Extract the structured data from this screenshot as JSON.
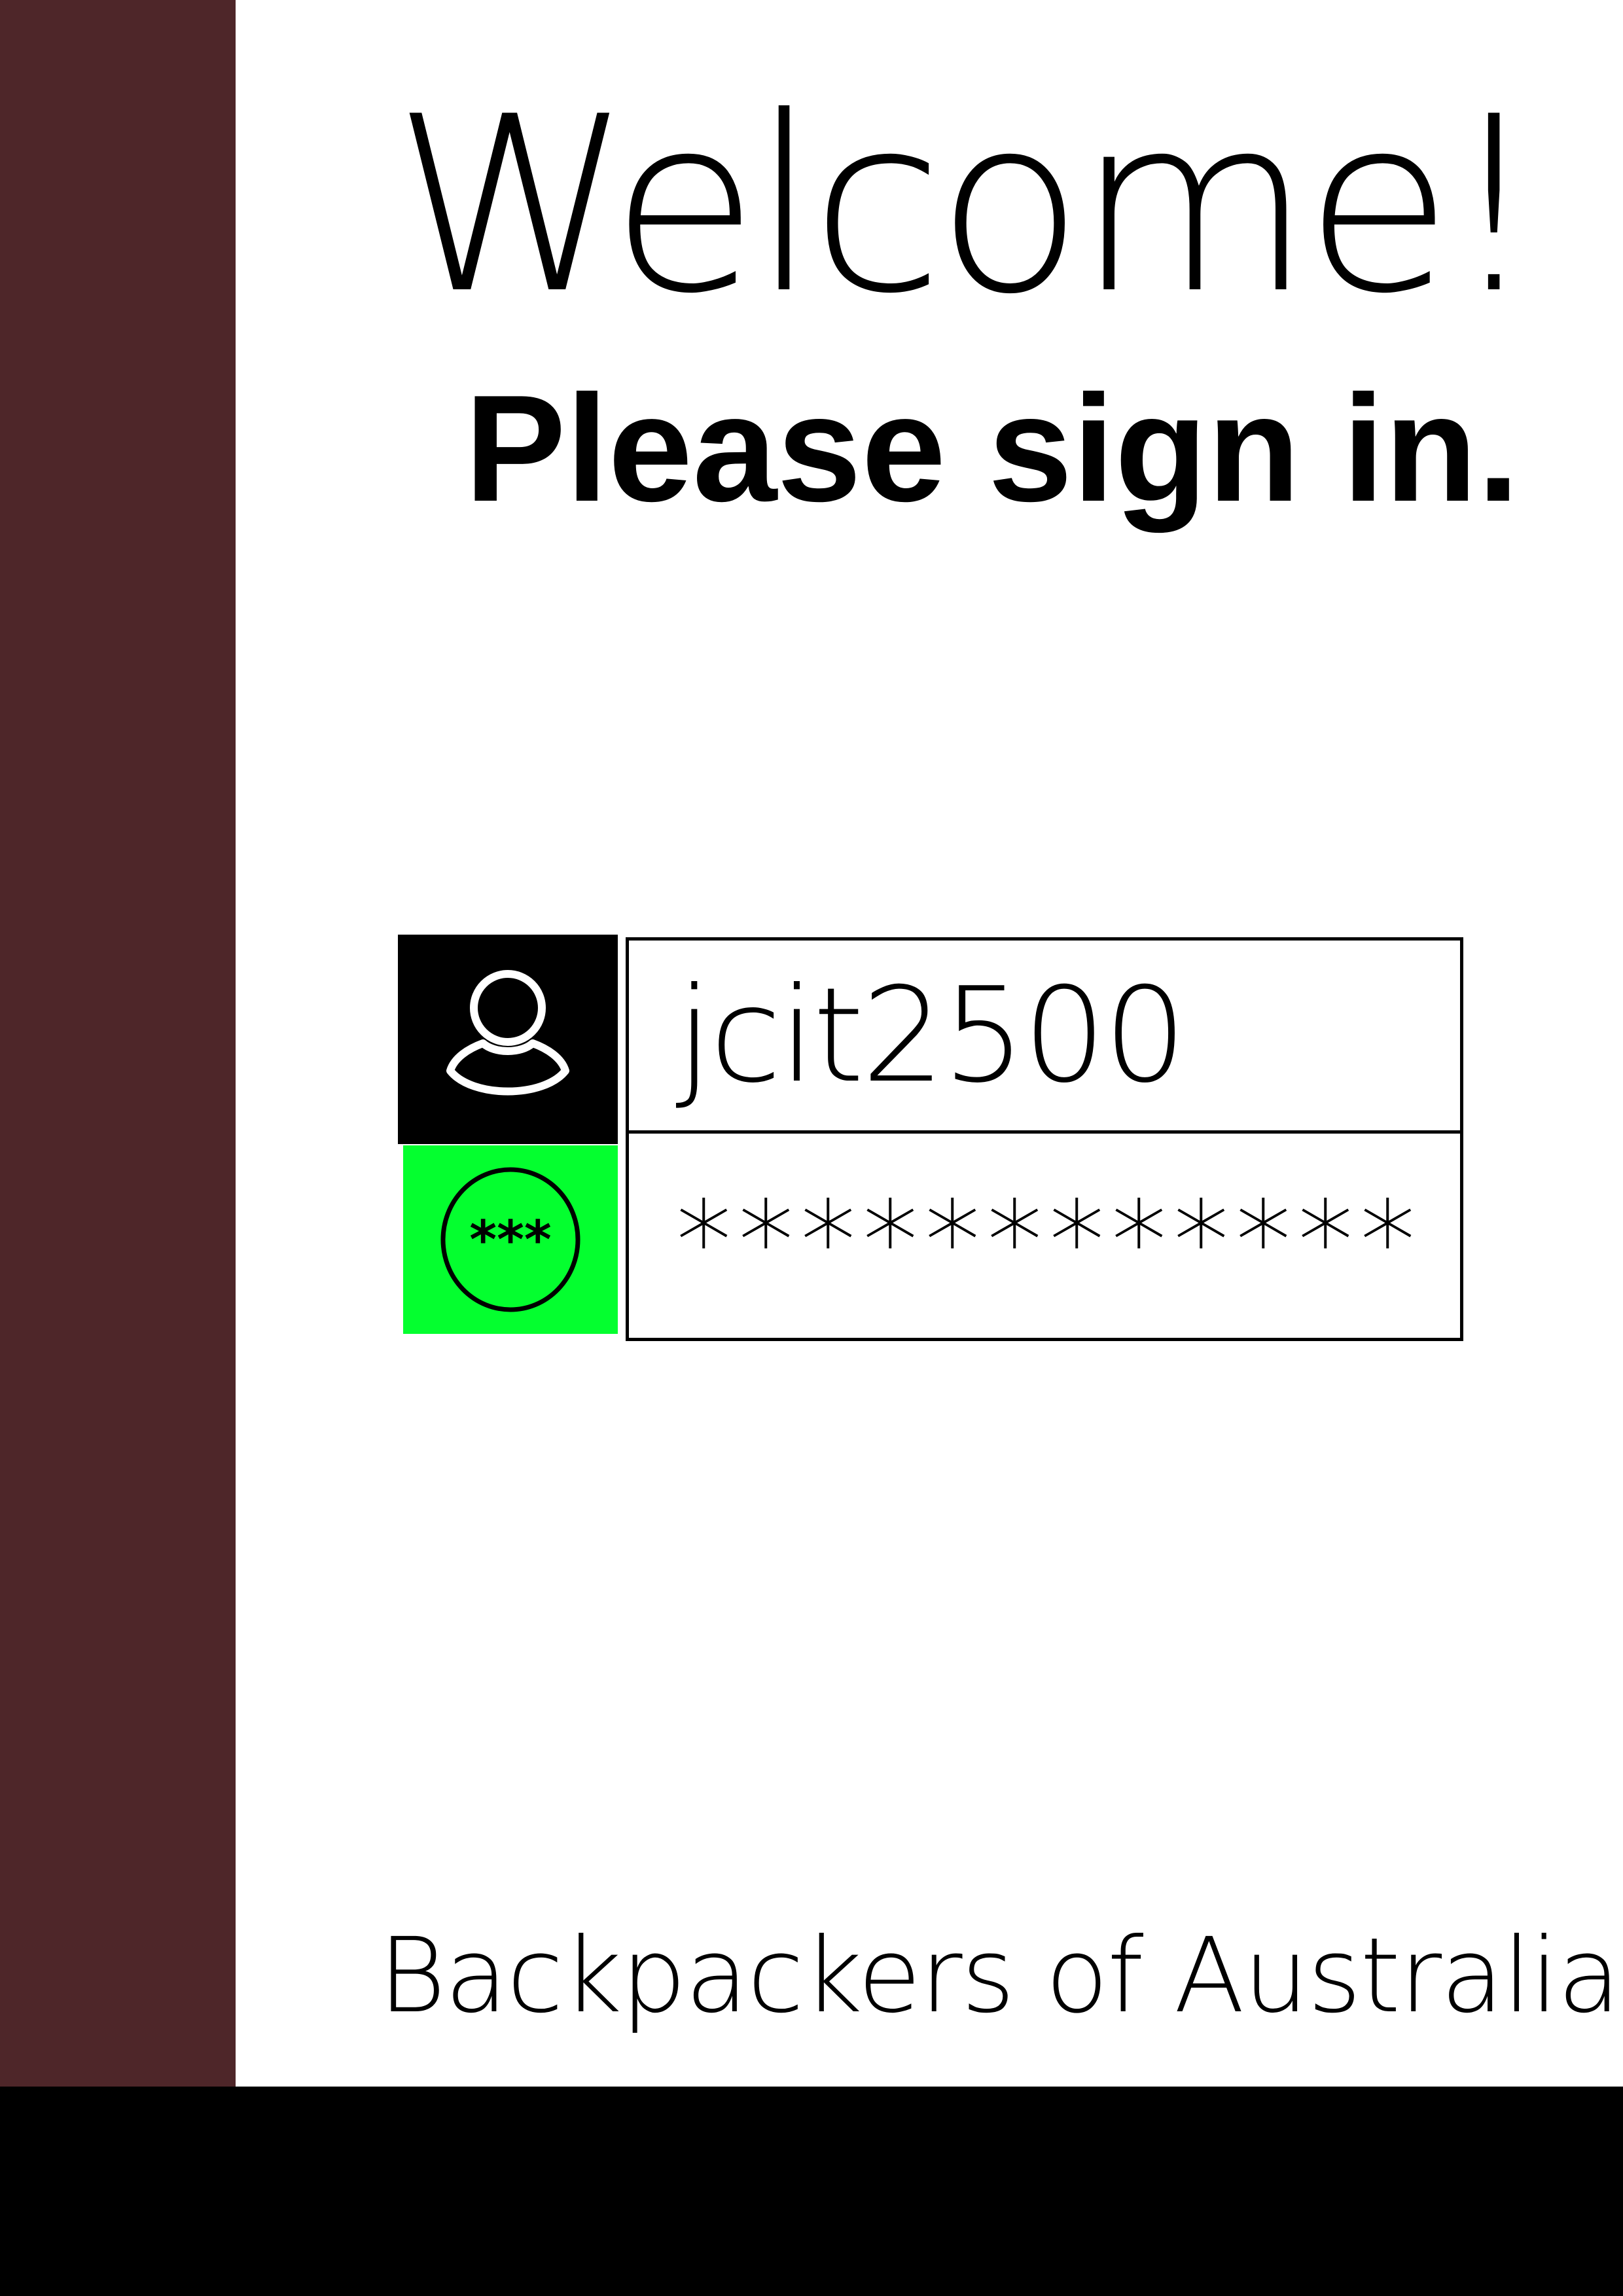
{
  "header": {
    "title": "Welcome!",
    "subtitle": "Please sign in."
  },
  "login": {
    "username": {
      "icon": "user-icon",
      "value": "jcit2500"
    },
    "password": {
      "icon": "password-icon",
      "value": "************"
    }
  },
  "footer": {
    "organization": "Backpackers of Australia"
  },
  "colors": {
    "sidebar": "#4e2629",
    "footer_bar": "#000000",
    "user_icon_bg": "#000000",
    "password_icon_bg": "#04ff2f",
    "background": "#ffffff"
  }
}
